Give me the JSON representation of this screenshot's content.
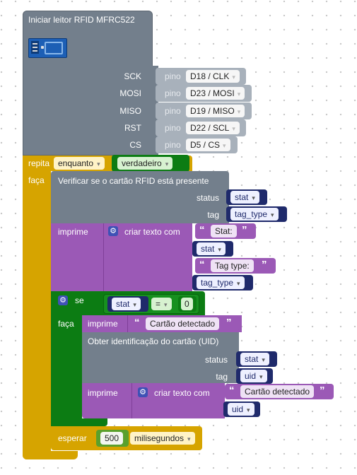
{
  "init_block": {
    "title": "Iniciar leitor RFID MFRC522",
    "image_icon": "rfid-module-icon",
    "pins": [
      {
        "label": "SCK",
        "pin_word": "pino",
        "value": "D18 / CLK"
      },
      {
        "label": "MOSI",
        "pin_word": "pino",
        "value": "D23 / MOSI"
      },
      {
        "label": "MISO",
        "pin_word": "pino",
        "value": "D19 / MISO"
      },
      {
        "label": "RST",
        "pin_word": "pino",
        "value": "D22 / SCL"
      },
      {
        "label": "CS",
        "pin_word": "pino",
        "value": "D5 / CS"
      }
    ]
  },
  "loop_block": {
    "repeat_label": "repita",
    "mode": "enquanto",
    "condition": "verdadeiro",
    "do_label": "faça"
  },
  "check_block": {
    "title": "Verificar se o cartão RFID está presente",
    "status_label": "status",
    "status_var": "stat",
    "tag_label": "tag",
    "tag_var": "tag_type"
  },
  "print_block_1": {
    "print_label": "imprime",
    "create_text_label": "criar texto com",
    "text1": "Stat:",
    "var1": "stat",
    "text2": "Tag type:",
    "var2": "tag_type"
  },
  "if_block": {
    "if_label": "se",
    "left_var": "stat",
    "operator": "=",
    "right_value": "0",
    "do_label": "faça"
  },
  "print_block_2": {
    "print_label": "imprime",
    "text": "Cartão detectado"
  },
  "uid_block": {
    "title": "Obter identificação do cartão (UID)",
    "status_label": "status",
    "status_var": "stat",
    "tag_label": "tag",
    "tag_var": "uid"
  },
  "print_block_3": {
    "print_label": "imprime",
    "create_text_label": "criar texto com",
    "text1": "Cartão detectado",
    "var1": "uid"
  },
  "wait_block": {
    "label": "esperar",
    "value": "500",
    "unit": "milisegundos"
  },
  "colors": {
    "rfid_block": "#737f8c",
    "loop_block": "#d6a400",
    "logic_block": "#0c7c13",
    "text_block": "#9b59b6",
    "variable_block": "#1f2a6b"
  }
}
